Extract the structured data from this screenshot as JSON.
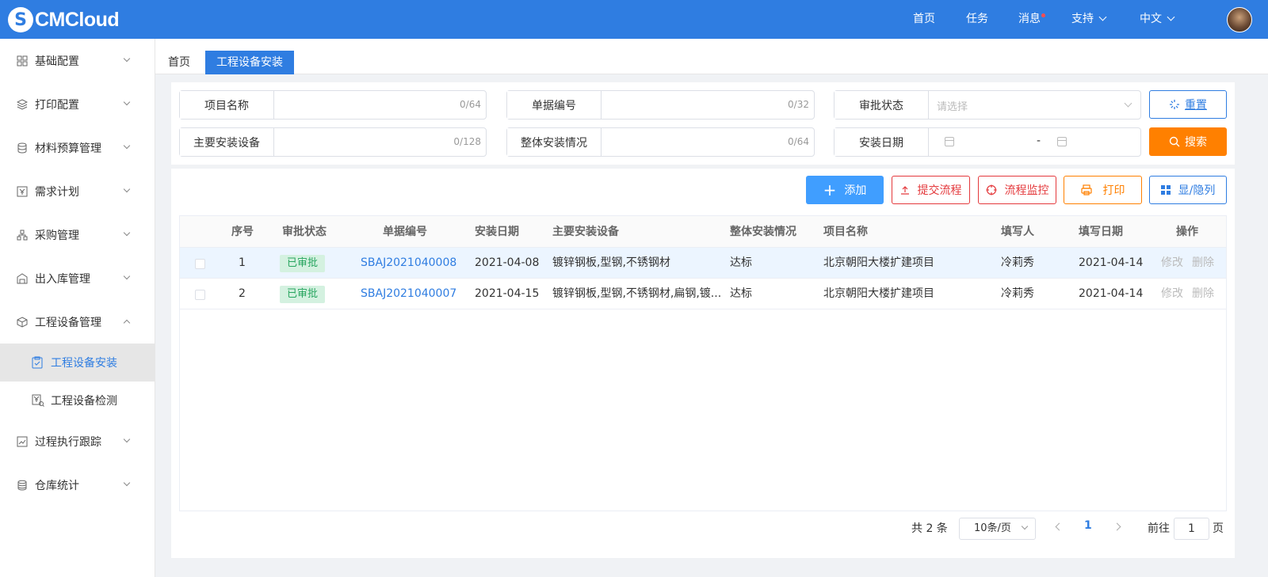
{
  "app": {
    "logo_text": "CMCloud"
  },
  "topnav": {
    "home": "首页",
    "tasks": "任务",
    "messages": "消息",
    "support": "支持",
    "language": "中文"
  },
  "sidebar": {
    "items": [
      {
        "label": "基础配置",
        "icon": "grid-icon"
      },
      {
        "label": "打印配置",
        "icon": "layers-icon"
      },
      {
        "label": "材料预算管理",
        "icon": "database-icon"
      },
      {
        "label": "需求计划",
        "icon": "yen-doc-icon"
      },
      {
        "label": "采购管理",
        "icon": "org-icon"
      },
      {
        "label": "出入库管理",
        "icon": "warehouse-icon"
      },
      {
        "label": "工程设备管理",
        "icon": "box-icon"
      },
      {
        "label": "过程执行跟踪",
        "icon": "track-icon"
      },
      {
        "label": "仓库统计",
        "icon": "coins-icon"
      }
    ],
    "sub_items": [
      {
        "label": "工程设备安装",
        "icon": "clipboard-check-icon"
      },
      {
        "label": "工程设备检测",
        "icon": "yen-search-icon"
      }
    ]
  },
  "tabs": [
    {
      "label": "首页"
    },
    {
      "label": "工程设备安装"
    }
  ],
  "filter": {
    "project_name": {
      "label": "项目名称",
      "counter": "0/64"
    },
    "doc_no": {
      "label": "单据编号",
      "counter": "0/32"
    },
    "approval_status": {
      "label": "审批状态",
      "placeholder": "请选择"
    },
    "main_equipment": {
      "label": "主要安装设备",
      "counter": "0/128"
    },
    "overall_status": {
      "label": "整体安装情况",
      "counter": "0/64"
    },
    "install_date": {
      "label": "安装日期",
      "separator": "-"
    },
    "reset_label": "重置",
    "search_label": "搜索"
  },
  "toolbar": {
    "add": "添加",
    "submit_flow": "提交流程",
    "monitor_flow": "流程监控",
    "print": "打印",
    "toggle_cols": "显/隐列"
  },
  "colors": {
    "primary": "#2f7de1",
    "orange": "#ff8000",
    "danger": "#e4393c",
    "success_bg": "#d4f1e0",
    "success_fg": "#27a55f"
  },
  "table": {
    "headers": [
      "序号",
      "审批状态",
      "单据编号",
      "安装日期",
      "主要安装设备",
      "整体安装情况",
      "项目名称",
      "填写人",
      "填写日期",
      "操作"
    ],
    "rows": [
      {
        "no": "1",
        "status": "已审批",
        "doc_no": "SBAJ2021040008",
        "date": "2021-04-08",
        "equipment": "镀锌钢板,型钢,不锈钢材",
        "overall": "达标",
        "project": "北京朝阳大楼扩建项目",
        "filler": "冷莉秀",
        "fill_date": "2021-04-14",
        "edit": "修改",
        "delete": "删除"
      },
      {
        "no": "2",
        "status": "已审批",
        "doc_no": "SBAJ2021040007",
        "date": "2021-04-15",
        "equipment": "镀锌钢板,型钢,不锈钢材,扁钢,镀...",
        "overall": "达标",
        "project": "北京朝阳大楼扩建项目",
        "filler": "冷莉秀",
        "fill_date": "2021-04-14",
        "edit": "修改",
        "delete": "删除"
      }
    ]
  },
  "pagination": {
    "total_text": "共 2 条",
    "page_size": "10条/页",
    "current": "1",
    "goto_label": "前往",
    "goto_value": "1",
    "page_suffix": "页"
  }
}
